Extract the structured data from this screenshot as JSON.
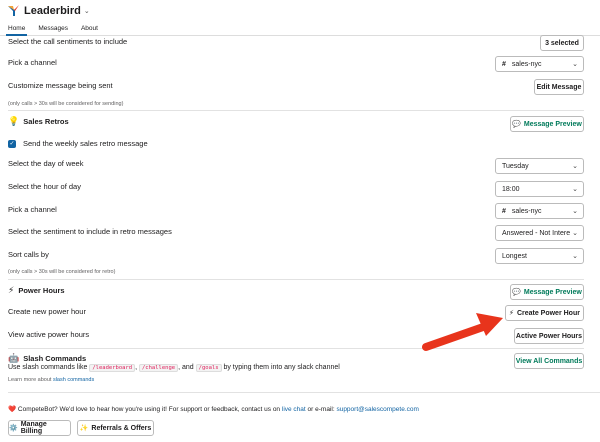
{
  "header": {
    "app_title": "Leaderbird",
    "caret": "⌄"
  },
  "tabs": [
    {
      "label": "Home",
      "active": true
    },
    {
      "label": "Messages",
      "active": false
    },
    {
      "label": "About",
      "active": false
    }
  ],
  "top": {
    "select_sentiments_label": "Select the call sentiments to include",
    "selected_button": "3 selected",
    "pick_channel_label": "Pick a channel",
    "channel_value": "sales-nyc",
    "customize_label": "Customize message being sent",
    "edit_message_button": "Edit Message",
    "note": "(only calls > 30s will be considered for sending)"
  },
  "sales_retros": {
    "title": "Sales Retros",
    "title_icon": "lightbulb-icon",
    "preview_button": "Message Preview",
    "checkbox_label": "Send the weekly sales retro message",
    "day_label": "Select the day of week",
    "day_value": "Tuesday",
    "hour_label": "Select the hour of day",
    "hour_value": "18:00",
    "channel_label": "Pick a channel",
    "channel_value": "sales-nyc",
    "sentiment_label": "Select the sentiment to include in retro messages",
    "sentiment_value": "Answered - Not Intere",
    "sort_label": "Sort calls by",
    "sort_value": "Longest",
    "note": "(only calls > 30s will be considered for retro)"
  },
  "power_hours": {
    "title": "Power Hours",
    "title_icon": "lightning-icon",
    "preview_button": "Message Preview",
    "create_label": "Create new power hour",
    "create_button": "Create Power Hour",
    "view_label": "View active power hours",
    "active_button": "Active Power Hours"
  },
  "slash_commands": {
    "title": "Slash Commands",
    "title_icon": "robot-icon",
    "text_prefix": "Use slash commands like",
    "cmd1": "/leaderboard",
    "sep1": ",",
    "cmd2": "/challenge",
    "sep2": ", and",
    "cmd3": "/goals",
    "text_suffix": "by typing them into any slack channel",
    "learn_prefix": "Learn more about",
    "learn_link": "slash commands",
    "view_all_button": "View All Commands"
  },
  "footer": {
    "heart_icon": "heart-icon",
    "text1": "CompeteBot? We'd love to hear how you're using it! For support or feedback, contact us on",
    "live_chat": "live chat",
    "text2": "or e-mail:",
    "email": "support@salescompete.com",
    "manage_billing_button": "Manage Billing",
    "referrals_button": "Referrals & Offers"
  },
  "colors": {
    "accent_blue": "#1264a3",
    "green": "#007a5a",
    "arrow_red": "#e8341c"
  }
}
